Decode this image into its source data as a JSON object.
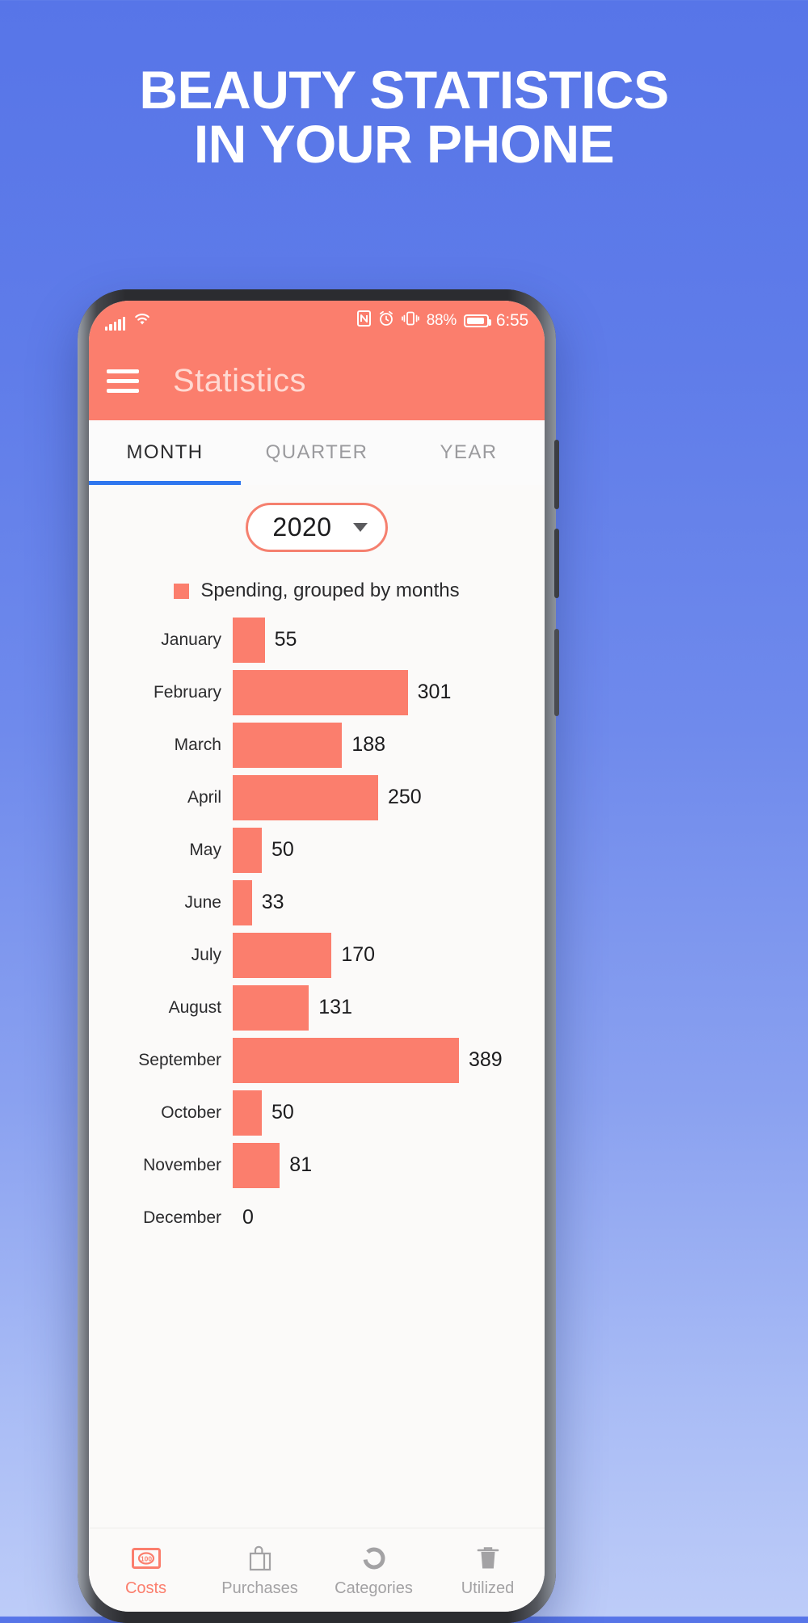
{
  "headline": {
    "line1": "BEAUTY STATISTICS",
    "line2": "IN YOUR PHONE"
  },
  "status_bar": {
    "signal_icon": "signal-bars-icon",
    "wifi_icon": "wifi-icon",
    "nfc_icon": "nfc-icon",
    "alarm_icon": "alarm-clock-icon",
    "vibrate_icon": "vibrate-icon",
    "battery_percent": "88%",
    "battery_icon": "battery-icon",
    "time": "6:55"
  },
  "app_bar": {
    "menu_icon": "hamburger-menu-icon",
    "title": "Statistics"
  },
  "tabs": [
    {
      "label": "MONTH",
      "active": true
    },
    {
      "label": "QUARTER",
      "active": false
    },
    {
      "label": "YEAR",
      "active": false
    }
  ],
  "year_select": {
    "value": "2020",
    "caret_icon": "chevron-down-icon"
  },
  "legend": {
    "swatch_color": "#fb7e6d",
    "label": "Spending, grouped by months"
  },
  "colors": {
    "accent": "#fb7e6d",
    "tab_underline": "#2f77ef",
    "screen_bg": "#fbfaf9"
  },
  "chart_data": {
    "type": "bar",
    "orientation": "horizontal",
    "title": "Spending, grouped by months",
    "xlabel": "",
    "ylabel": "",
    "grid": false,
    "legend_position": "top",
    "xlim": [
      0,
      389
    ],
    "categories": [
      "January",
      "February",
      "March",
      "April",
      "May",
      "June",
      "July",
      "August",
      "September",
      "October",
      "November",
      "December"
    ],
    "values": [
      55,
      301,
      188,
      250,
      50,
      33,
      170,
      131,
      389,
      50,
      81,
      0
    ],
    "value_labels": [
      "55",
      "301",
      "188",
      "250",
      "50",
      "33",
      "170",
      "131",
      "389",
      "50",
      "81",
      "0"
    ],
    "series": [
      {
        "name": "Spending, grouped by months",
        "color": "#fb7e6d",
        "values": [
          55,
          301,
          188,
          250,
          50,
          33,
          170,
          131,
          389,
          50,
          81,
          0
        ]
      }
    ]
  },
  "bottom_nav": [
    {
      "label": "Costs",
      "icon": "banknote-100-icon",
      "active": true
    },
    {
      "label": "Purchases",
      "icon": "shopping-bag-icon",
      "active": false
    },
    {
      "label": "Categories",
      "icon": "donut-chart-icon",
      "active": false
    },
    {
      "label": "Utilized",
      "icon": "trash-can-icon",
      "active": false
    }
  ]
}
